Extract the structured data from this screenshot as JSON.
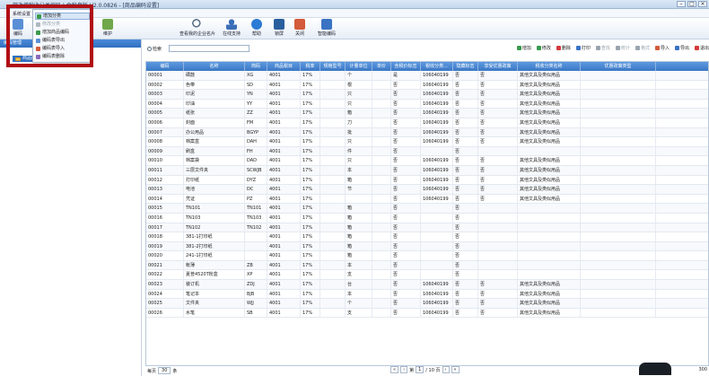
{
  "window": {
    "title": "营改增税收分类编码 | 金税盘版 V2.0.0826 - [商品编码设置]",
    "min": "–",
    "max": "□",
    "close": "×"
  },
  "menu": {
    "system": "系统设置"
  },
  "toolbar": {
    "items": [
      {
        "label": "编码",
        "icon": "code-icon",
        "color": "#5a8fd6"
      },
      {
        "label": "维护",
        "icon": "maintain-icon",
        "color": "#6fa84a"
      },
      {
        "label": "查看我的企业名片",
        "icon": "magnifier-icon",
        "color": "#5a6f85"
      },
      {
        "label": "在线支持",
        "icon": "person-icon",
        "color": "#3b6fb8"
      },
      {
        "label": "帮助",
        "icon": "help-icon",
        "color": "#2b7ad4"
      },
      {
        "label": "锁屏",
        "icon": "monitor-icon",
        "color": "#2a5f9e"
      },
      {
        "label": "关闭",
        "icon": "close-door-icon",
        "color": "#d35a3a"
      },
      {
        "label": "智能编码",
        "icon": "flag-icon",
        "color": "#3a73c4"
      }
    ]
  },
  "dropdown": {
    "items": [
      {
        "label": "增加分类",
        "icon": "add-category-icon",
        "highlighted": true,
        "disabled": false,
        "color": "#3a9a4e"
      },
      {
        "label": "修改分类",
        "icon": "edit-category-icon",
        "highlighted": false,
        "disabled": true,
        "color": "#b0b8c2"
      },
      {
        "label": "增加商品编码",
        "icon": "add-code-icon",
        "highlighted": false,
        "disabled": false,
        "color": "#3a9a4e"
      },
      {
        "label": "编码表导出",
        "icon": "export-icon",
        "highlighted": false,
        "disabled": false,
        "color": "#5a8fd6"
      },
      {
        "label": "编码表导入",
        "icon": "import-icon",
        "highlighted": false,
        "disabled": false,
        "color": "#d35a3a"
      },
      {
        "label": "编码表删除",
        "icon": "delete-icon",
        "highlighted": false,
        "disabled": false,
        "color": "#8a6ab8"
      }
    ]
  },
  "left": {
    "header": "编码管理",
    "tree_item": "商品编码"
  },
  "search": {
    "label": "检索",
    "value": ""
  },
  "actions": [
    {
      "label": "增加",
      "icon": "add-icon",
      "color": "#3a9a4e",
      "disabled": false
    },
    {
      "label": "修改",
      "icon": "edit-icon",
      "color": "#3a9a4e",
      "disabled": false
    },
    {
      "label": "删除",
      "icon": "delete-icon",
      "color": "#d33a3a",
      "disabled": false
    },
    {
      "label": "打印",
      "icon": "print-icon",
      "color": "#3a73c4",
      "disabled": false
    },
    {
      "label": "查找",
      "icon": "find-icon",
      "color": "#9aa4af",
      "disabled": true
    },
    {
      "label": "统计",
      "icon": "stats-icon",
      "color": "#9aa4af",
      "disabled": true
    },
    {
      "label": "格式",
      "icon": "format-icon",
      "color": "#9aa4af",
      "disabled": true
    },
    {
      "label": "导入",
      "icon": "import-icon",
      "color": "#d35a3a",
      "disabled": false
    },
    {
      "label": "导出",
      "icon": "export-icon",
      "color": "#3a73c4",
      "disabled": false
    },
    {
      "label": "退出",
      "icon": "exit-icon",
      "color": "#d33a3a",
      "disabled": false
    }
  ],
  "table": {
    "columns": [
      "编码",
      "名称",
      "简码",
      "商品税目",
      "税率",
      "规格型号",
      "计量单位",
      "单价",
      "含税价标志",
      "税收分类...",
      "隐藏标志",
      "享受优惠政策",
      "税收分类名称",
      "优惠政策类型"
    ],
    "rows": [
      [
        "00001",
        "硒鼓",
        "XG",
        "4001",
        "17%",
        "",
        "个",
        "",
        "是",
        "106040199",
        "否",
        "否",
        "其他文具及类似用品",
        ""
      ],
      [
        "00002",
        "色带",
        "SD",
        "4001",
        "17%",
        "",
        "根",
        "",
        "否",
        "106040199",
        "否",
        "否",
        "其他文具及类似用品",
        ""
      ],
      [
        "00003",
        "印泥",
        "YN",
        "4001",
        "17%",
        "",
        "只",
        "",
        "否",
        "106040199",
        "否",
        "否",
        "其他文具及类似用品",
        ""
      ],
      [
        "00004",
        "印油",
        "YY",
        "4001",
        "17%",
        "",
        "只",
        "",
        "否",
        "106040199",
        "否",
        "否",
        "其他文具及类似用品",
        ""
      ],
      [
        "00005",
        "纸张",
        "ZZ",
        "4001",
        "17%",
        "",
        "箱",
        "",
        "否",
        "106040199",
        "否",
        "否",
        "其他文具及类似用品",
        ""
      ],
      [
        "00006",
        "封面",
        "FM",
        "4001",
        "17%",
        "",
        "刀",
        "",
        "否",
        "106040199",
        "否",
        "否",
        "其他文具及类似用品",
        ""
      ],
      [
        "00007",
        "办公用品",
        "BGYP",
        "4001",
        "17%",
        "",
        "批",
        "",
        "否",
        "106040199",
        "否",
        "否",
        "其他文具及类似用品",
        ""
      ],
      [
        "00008",
        "档案盒",
        "DAH",
        "4001",
        "17%",
        "",
        "只",
        "",
        "否",
        "106040199",
        "否",
        "否",
        "其他文具及类似用品",
        ""
      ],
      [
        "00009",
        "刷盒",
        "FH",
        "4001",
        "17%",
        "",
        "件",
        "",
        "否",
        "",
        "否",
        "",
        "",
        ""
      ],
      [
        "00010",
        "档案袋",
        "DAD",
        "4001",
        "17%",
        "",
        "只",
        "",
        "否",
        "106040199",
        "否",
        "否",
        "其他文具及类似用品",
        ""
      ],
      [
        "00011",
        "三层文件夹",
        "SCWJB",
        "4001",
        "17%",
        "",
        "本",
        "",
        "否",
        "106040199",
        "否",
        "否",
        "其他文具及类似用品",
        ""
      ],
      [
        "00012",
        "打印纸",
        "DYZ",
        "4001",
        "17%",
        "",
        "箱",
        "",
        "否",
        "106040199",
        "否",
        "否",
        "其他文具及类似用品",
        ""
      ],
      [
        "00013",
        "电池",
        "DC",
        "4001",
        "17%",
        "",
        "节",
        "",
        "否",
        "106040199",
        "否",
        "否",
        "其他文具及类似用品",
        ""
      ],
      [
        "00014",
        "凭证",
        "PZ",
        "4001",
        "17%",
        "",
        "",
        "",
        "否",
        "106040199",
        "否",
        "否",
        "其他文具及类似用品",
        ""
      ],
      [
        "00015",
        "TN101",
        "TN101",
        "4001",
        "17%",
        "",
        "箱",
        "",
        "否",
        "",
        "否",
        "",
        "",
        ""
      ],
      [
        "00016",
        "TN103",
        "TN103",
        "4001",
        "17%",
        "",
        "箱",
        "",
        "否",
        "",
        "否",
        "",
        "",
        ""
      ],
      [
        "00017",
        "TN102",
        "TN102",
        "4001",
        "17%",
        "",
        "箱",
        "",
        "否",
        "",
        "否",
        "",
        "",
        ""
      ],
      [
        "00018",
        "381-1打印纸",
        "",
        "4001",
        "17%",
        "",
        "箱",
        "",
        "否",
        "",
        "否",
        "",
        "",
        ""
      ],
      [
        "00019",
        "381-2打印纸",
        "",
        "4001",
        "17%",
        "",
        "箱",
        "",
        "否",
        "",
        "否",
        "",
        "",
        ""
      ],
      [
        "00020",
        "241-1打印纸",
        "",
        "4001",
        "17%",
        "",
        "箱",
        "",
        "否",
        "",
        "否",
        "",
        "",
        ""
      ],
      [
        "00021",
        "帐薄",
        "ZB",
        "4001",
        "17%",
        "",
        "本",
        "",
        "否",
        "",
        "否",
        "",
        "",
        ""
      ],
      [
        "00022",
        "夏普4520T粉盒",
        "XP",
        "4001",
        "17%",
        "",
        "支",
        "",
        "否",
        "",
        "否",
        "",
        "",
        ""
      ],
      [
        "00023",
        "装订机",
        "ZDJ",
        "4001",
        "17%",
        "",
        "台",
        "",
        "否",
        "106040199",
        "否",
        "否",
        "其他文具及类似用品",
        ""
      ],
      [
        "00024",
        "笔记本",
        "BJB",
        "4001",
        "17%",
        "",
        "本",
        "",
        "否",
        "106040199",
        "否",
        "否",
        "其他文具及类似用品",
        ""
      ],
      [
        "00025",
        "文件夹",
        "WJJ",
        "4001",
        "17%",
        "",
        "个",
        "",
        "否",
        "106040199",
        "否",
        "否",
        "其他文具及类似用品",
        ""
      ],
      [
        "00026",
        "水笔",
        "SB",
        "4001",
        "17%",
        "",
        "支",
        "",
        "否",
        "106040199",
        "否",
        "否",
        "其他文具及类似用品",
        ""
      ]
    ]
  },
  "pager": {
    "page_size_label": "每页",
    "page_size": "30",
    "unit": "条",
    "page_prefix": "第",
    "current_page": "1",
    "page_of": "/ 10 页",
    "total": "300"
  },
  "colors": {
    "header_blue": "#3b78c5",
    "frame_red": "#b00e14"
  }
}
